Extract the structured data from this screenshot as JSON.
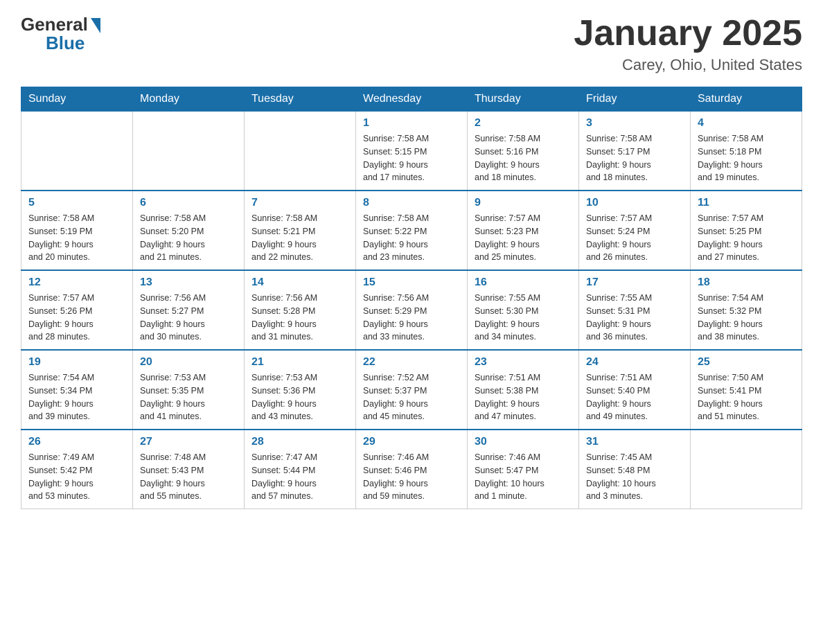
{
  "logo": {
    "general": "General",
    "blue": "Blue"
  },
  "title": "January 2025",
  "location": "Carey, Ohio, United States",
  "days_of_week": [
    "Sunday",
    "Monday",
    "Tuesday",
    "Wednesday",
    "Thursday",
    "Friday",
    "Saturday"
  ],
  "weeks": [
    [
      {
        "day": "",
        "info": ""
      },
      {
        "day": "",
        "info": ""
      },
      {
        "day": "",
        "info": ""
      },
      {
        "day": "1",
        "info": "Sunrise: 7:58 AM\nSunset: 5:15 PM\nDaylight: 9 hours\nand 17 minutes."
      },
      {
        "day": "2",
        "info": "Sunrise: 7:58 AM\nSunset: 5:16 PM\nDaylight: 9 hours\nand 18 minutes."
      },
      {
        "day": "3",
        "info": "Sunrise: 7:58 AM\nSunset: 5:17 PM\nDaylight: 9 hours\nand 18 minutes."
      },
      {
        "day": "4",
        "info": "Sunrise: 7:58 AM\nSunset: 5:18 PM\nDaylight: 9 hours\nand 19 minutes."
      }
    ],
    [
      {
        "day": "5",
        "info": "Sunrise: 7:58 AM\nSunset: 5:19 PM\nDaylight: 9 hours\nand 20 minutes."
      },
      {
        "day": "6",
        "info": "Sunrise: 7:58 AM\nSunset: 5:20 PM\nDaylight: 9 hours\nand 21 minutes."
      },
      {
        "day": "7",
        "info": "Sunrise: 7:58 AM\nSunset: 5:21 PM\nDaylight: 9 hours\nand 22 minutes."
      },
      {
        "day": "8",
        "info": "Sunrise: 7:58 AM\nSunset: 5:22 PM\nDaylight: 9 hours\nand 23 minutes."
      },
      {
        "day": "9",
        "info": "Sunrise: 7:57 AM\nSunset: 5:23 PM\nDaylight: 9 hours\nand 25 minutes."
      },
      {
        "day": "10",
        "info": "Sunrise: 7:57 AM\nSunset: 5:24 PM\nDaylight: 9 hours\nand 26 minutes."
      },
      {
        "day": "11",
        "info": "Sunrise: 7:57 AM\nSunset: 5:25 PM\nDaylight: 9 hours\nand 27 minutes."
      }
    ],
    [
      {
        "day": "12",
        "info": "Sunrise: 7:57 AM\nSunset: 5:26 PM\nDaylight: 9 hours\nand 28 minutes."
      },
      {
        "day": "13",
        "info": "Sunrise: 7:56 AM\nSunset: 5:27 PM\nDaylight: 9 hours\nand 30 minutes."
      },
      {
        "day": "14",
        "info": "Sunrise: 7:56 AM\nSunset: 5:28 PM\nDaylight: 9 hours\nand 31 minutes."
      },
      {
        "day": "15",
        "info": "Sunrise: 7:56 AM\nSunset: 5:29 PM\nDaylight: 9 hours\nand 33 minutes."
      },
      {
        "day": "16",
        "info": "Sunrise: 7:55 AM\nSunset: 5:30 PM\nDaylight: 9 hours\nand 34 minutes."
      },
      {
        "day": "17",
        "info": "Sunrise: 7:55 AM\nSunset: 5:31 PM\nDaylight: 9 hours\nand 36 minutes."
      },
      {
        "day": "18",
        "info": "Sunrise: 7:54 AM\nSunset: 5:32 PM\nDaylight: 9 hours\nand 38 minutes."
      }
    ],
    [
      {
        "day": "19",
        "info": "Sunrise: 7:54 AM\nSunset: 5:34 PM\nDaylight: 9 hours\nand 39 minutes."
      },
      {
        "day": "20",
        "info": "Sunrise: 7:53 AM\nSunset: 5:35 PM\nDaylight: 9 hours\nand 41 minutes."
      },
      {
        "day": "21",
        "info": "Sunrise: 7:53 AM\nSunset: 5:36 PM\nDaylight: 9 hours\nand 43 minutes."
      },
      {
        "day": "22",
        "info": "Sunrise: 7:52 AM\nSunset: 5:37 PM\nDaylight: 9 hours\nand 45 minutes."
      },
      {
        "day": "23",
        "info": "Sunrise: 7:51 AM\nSunset: 5:38 PM\nDaylight: 9 hours\nand 47 minutes."
      },
      {
        "day": "24",
        "info": "Sunrise: 7:51 AM\nSunset: 5:40 PM\nDaylight: 9 hours\nand 49 minutes."
      },
      {
        "day": "25",
        "info": "Sunrise: 7:50 AM\nSunset: 5:41 PM\nDaylight: 9 hours\nand 51 minutes."
      }
    ],
    [
      {
        "day": "26",
        "info": "Sunrise: 7:49 AM\nSunset: 5:42 PM\nDaylight: 9 hours\nand 53 minutes."
      },
      {
        "day": "27",
        "info": "Sunrise: 7:48 AM\nSunset: 5:43 PM\nDaylight: 9 hours\nand 55 minutes."
      },
      {
        "day": "28",
        "info": "Sunrise: 7:47 AM\nSunset: 5:44 PM\nDaylight: 9 hours\nand 57 minutes."
      },
      {
        "day": "29",
        "info": "Sunrise: 7:46 AM\nSunset: 5:46 PM\nDaylight: 9 hours\nand 59 minutes."
      },
      {
        "day": "30",
        "info": "Sunrise: 7:46 AM\nSunset: 5:47 PM\nDaylight: 10 hours\nand 1 minute."
      },
      {
        "day": "31",
        "info": "Sunrise: 7:45 AM\nSunset: 5:48 PM\nDaylight: 10 hours\nand 3 minutes."
      },
      {
        "day": "",
        "info": ""
      }
    ]
  ]
}
